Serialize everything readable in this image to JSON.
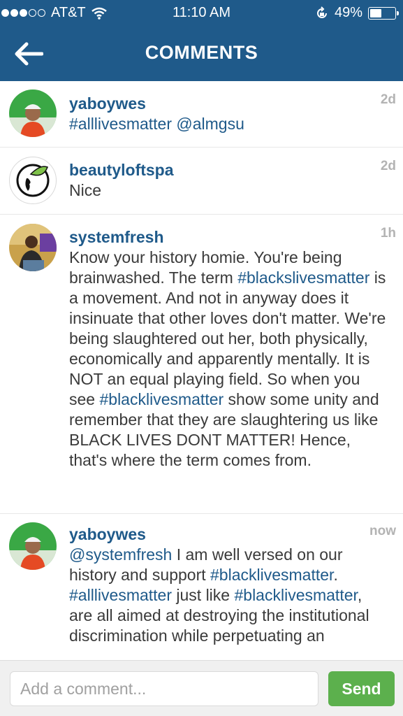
{
  "status_bar": {
    "carrier": "AT&T",
    "time": "11:10 AM",
    "battery": "49%",
    "battery_level": 0.49
  },
  "nav": {
    "back_icon": "arrow-left-icon",
    "title": "COMMENTS"
  },
  "comments": [
    {
      "username": "yaboywes",
      "time": "2d",
      "segments": [
        {
          "type": "hashtag",
          "text": "#alllivesmatter"
        },
        {
          "type": "text",
          "text": " "
        },
        {
          "type": "mention",
          "text": "@almgsu"
        }
      ]
    },
    {
      "username": "beautyloftspa",
      "time": "2d",
      "segments": [
        {
          "type": "text",
          "text": "Nice"
        }
      ]
    },
    {
      "username": "systemfresh",
      "time": "1h",
      "segments": [
        {
          "type": "text",
          "text": "Know your history homie. You're being brainwashed. The term "
        },
        {
          "type": "hashtag",
          "text": "#blackslivesmatter"
        },
        {
          "type": "text",
          "text": " is a movement. And not in anyway does it insinuate that other loves don't matter. We're being slaughtered out her, both physically, economically and apparently mentally. It is NOT an equal playing field. So when you see "
        },
        {
          "type": "hashtag",
          "text": "#blacklivesmatter"
        },
        {
          "type": "text",
          "text": " show some unity and remember that they are slaughtering us like BLACK LIVES DONT MATTER! Hence, that's where the term comes from."
        }
      ]
    },
    {
      "username": "yaboywes",
      "time": "now",
      "segments": [
        {
          "type": "mention",
          "text": "@systemfresh"
        },
        {
          "type": "text",
          "text": " I am well versed on our history and support "
        },
        {
          "type": "hashtag",
          "text": "#blacklivesmatter"
        },
        {
          "type": "text",
          "text": ". "
        },
        {
          "type": "hashtag",
          "text": "#alllivesmatter"
        },
        {
          "type": "text",
          "text": " just like "
        },
        {
          "type": "hashtag",
          "text": "#blacklivesmatter"
        },
        {
          "type": "text",
          "text": ", are all aimed at destroying the institutional discrimination while perpetuating an"
        }
      ]
    }
  ],
  "composer": {
    "placeholder": "Add a comment...",
    "send_label": "Send"
  },
  "colors": {
    "header": "#1f5a8a",
    "link": "#1f5a8a",
    "send": "#5cb04d"
  }
}
